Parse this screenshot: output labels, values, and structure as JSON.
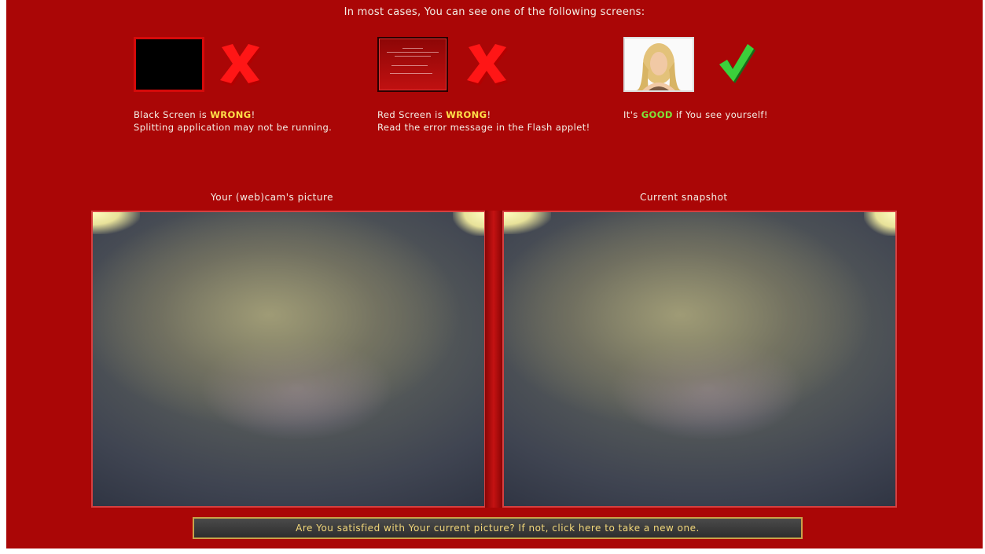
{
  "heading": "In most cases, You can see one of the following screens:",
  "examples": [
    {
      "pre": "Black Screen is ",
      "status": "WRONG",
      "post": "!",
      "detail": "Splitting application may not be running."
    },
    {
      "pre": "Red Screen is ",
      "status": "WRONG",
      "post": "!",
      "detail": "Read the error message in the Flash applet!"
    },
    {
      "pre": "It's ",
      "status": "GOOD",
      "post": " if You see yourself!",
      "detail": ""
    }
  ],
  "webcam_label": "Your (web)cam's picture",
  "snapshot_label": "Current snapshot",
  "retake_button": "Are You satisfied with Your current picture? If not, click here to take a new one.",
  "colors": {
    "background": "#aa0606",
    "wrong": "#ffe04a",
    "good": "#7fe53a"
  },
  "icons": [
    "cross-icon",
    "cross-icon",
    "checkmark-icon"
  ]
}
